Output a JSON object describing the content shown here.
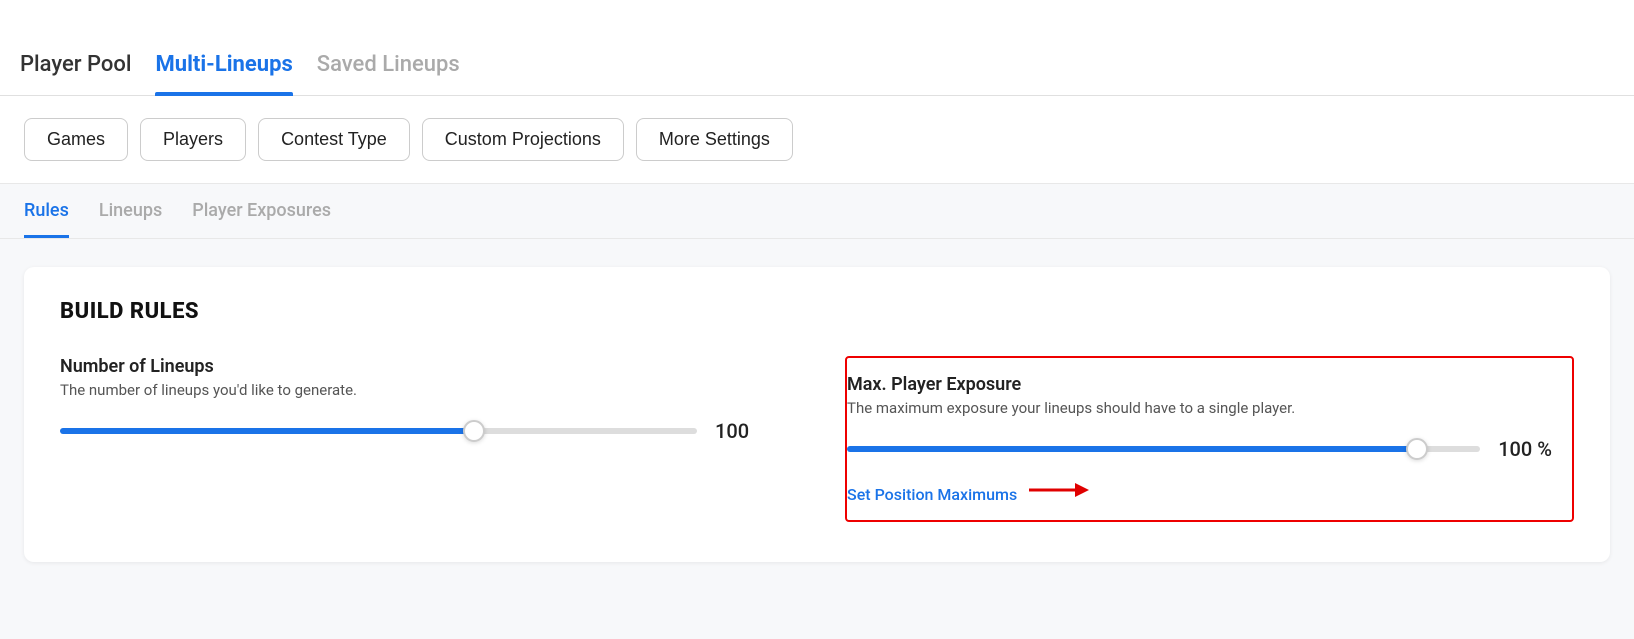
{
  "topNav": {
    "items": [
      {
        "id": "player-pool",
        "label": "Player Pool",
        "active": false
      },
      {
        "id": "multi-lineups",
        "label": "Multi-Lineups",
        "active": true
      },
      {
        "id": "saved-lineups",
        "label": "Saved Lineups",
        "active": false
      }
    ]
  },
  "filterBar": {
    "buttons": [
      {
        "id": "games",
        "label": "Games"
      },
      {
        "id": "players",
        "label": "Players"
      },
      {
        "id": "contest-type",
        "label": "Contest Type"
      },
      {
        "id": "custom-projections",
        "label": "Custom Projections"
      },
      {
        "id": "more-settings",
        "label": "More Settings"
      }
    ]
  },
  "subTabs": {
    "items": [
      {
        "id": "rules",
        "label": "Rules",
        "active": true
      },
      {
        "id": "lineups",
        "label": "Lineups",
        "active": false
      },
      {
        "id": "player-exposures",
        "label": "Player Exposures",
        "active": false
      }
    ]
  },
  "buildRules": {
    "title": "BUILD RULES",
    "numberOfLineups": {
      "label": "Number of Lineups",
      "description": "The number of lineups you'd like to generate.",
      "value": 100,
      "fillPercent": 65
    },
    "maxPlayerExposure": {
      "label": "Max. Player Exposure",
      "description": "The maximum exposure your lineups should have to a single player.",
      "value": "100 %",
      "fillPercent": 90
    },
    "setPositionMaximums": {
      "label": "Set Position Maximums"
    }
  },
  "colors": {
    "activeBlue": "#1a73e8",
    "highlightRed": "#e00000"
  }
}
